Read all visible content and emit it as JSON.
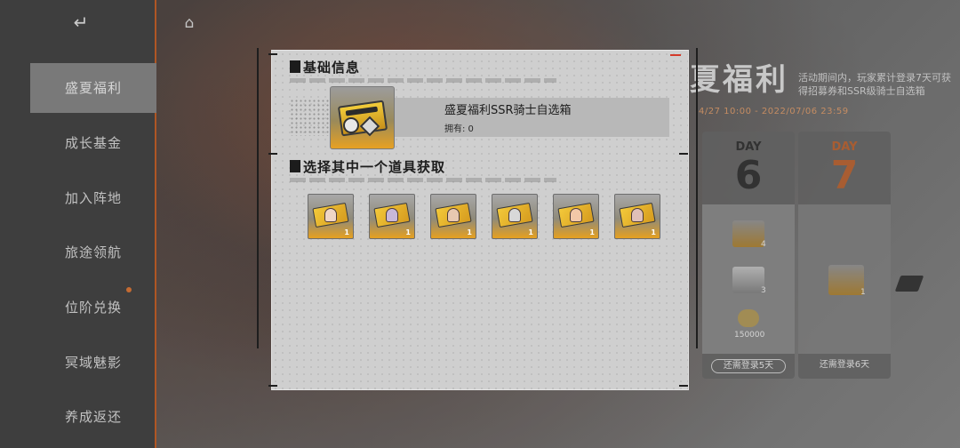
{
  "background": {
    "nav_items": [
      {
        "label": "盛夏福利",
        "active": true
      },
      {
        "label": "成长基金"
      },
      {
        "label": "加入阵地"
      },
      {
        "label": "旅途领航"
      },
      {
        "label": "位阶兑换"
      },
      {
        "label": "冥域魅影"
      },
      {
        "label": "养成返还"
      }
    ],
    "event_title": "夏福利",
    "event_desc": "活动期间内，玩家累计登录7天可获得招募券和SSR级骑士自选箱",
    "event_date": "4/27  10:00 - 2022/07/06  23:59",
    "days": [
      {
        "label": "DAY",
        "num": "6",
        "status": "还需登录5天",
        "reward_count_1": "4",
        "reward_count_2": "3",
        "reward_count_3": "150000"
      },
      {
        "label": "DAY",
        "num": "7",
        "status": "还需登录6天",
        "reward_count_1": "1"
      }
    ]
  },
  "modal": {
    "section_basic": "基础信息",
    "item_name": "盛夏福利SSR骑士自选箱",
    "owned": "拥有: 0",
    "section_choose": "选择其中一个道具获取",
    "options": [
      {
        "qty": "1",
        "portrait_color": "#f0d8c8"
      },
      {
        "qty": "1",
        "portrait_color": "#c8b8d8"
      },
      {
        "qty": "1",
        "portrait_color": "#e8c8b0"
      },
      {
        "qty": "1",
        "portrait_color": "#d8d8d8"
      },
      {
        "qty": "1",
        "portrait_color": "#f2c8a8"
      },
      {
        "qty": "1",
        "portrait_color": "#e0c0b8"
      }
    ]
  },
  "colors": {
    "accent_orange": "#c8622a",
    "item_gold": "#e7a123",
    "modal_bg": "#cfcfcf"
  }
}
